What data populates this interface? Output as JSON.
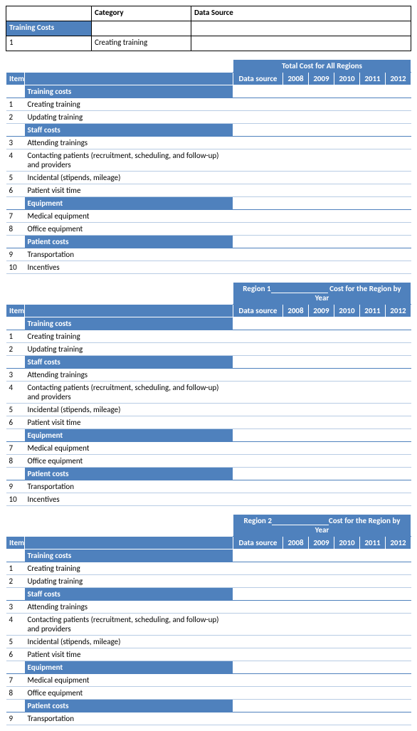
{
  "def_table": {
    "headers": {
      "category": "Category",
      "data_source": "Data Source"
    },
    "left_label": "Training Costs",
    "row1_num": "1",
    "row1_cat": "Creating training",
    "row1_ds": ""
  },
  "columns": {
    "item": "Item",
    "data_source": "Data source",
    "years": [
      "2008",
      "2009",
      "2010",
      "2011",
      "2012"
    ]
  },
  "sections": [
    {
      "key": "training",
      "label": "Training costs",
      "rows": [
        {
          "n": "1",
          "t": "Creating training"
        },
        {
          "n": "2",
          "t": "Updating training"
        }
      ]
    },
    {
      "key": "staff",
      "label": "Staff costs",
      "rows": [
        {
          "n": "3",
          "t": "Attending trainings"
        },
        {
          "n": "4",
          "t": "Contacting patients (recruitment, scheduling, and follow-up) and providers"
        },
        {
          "n": "5",
          "t": "Incidental (stipends, mileage)"
        },
        {
          "n": "6",
          "t": "Patient visit time"
        }
      ]
    },
    {
      "key": "equip",
      "label": "Equipment",
      "rows": [
        {
          "n": "7",
          "t": "Medical equipment"
        },
        {
          "n": "8",
          "t": "Office equipment"
        }
      ]
    },
    {
      "key": "patient",
      "label": "Patient costs",
      "rows": [
        {
          "n": "9",
          "t": "Transportation"
        },
        {
          "n": "10",
          "t": "Incentives"
        }
      ]
    }
  ],
  "blocks": [
    {
      "title_left": "",
      "title_right": "Total Cost for All Regions",
      "sections_limit": 4,
      "rows_limit": 99
    },
    {
      "title_left": "",
      "title_right_pre": "Region 1",
      "title_right_post": " Cost for the Region by Year",
      "sections_limit": 4,
      "rows_limit": 99
    },
    {
      "title_left": "",
      "title_right_pre": "Region 2",
      "title_right_post": "Cost for the Region by Year",
      "sections_limit": 4,
      "rows_limit_last_section": 1
    }
  ]
}
